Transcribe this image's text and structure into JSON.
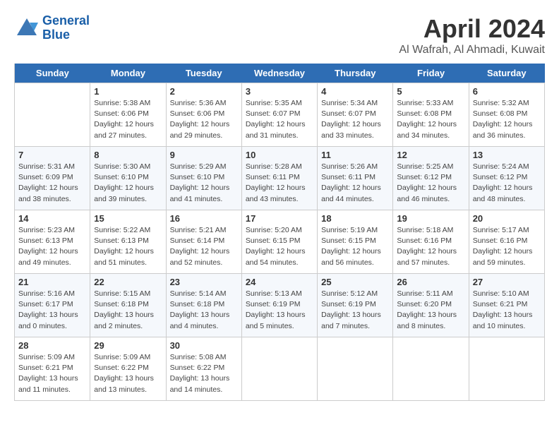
{
  "header": {
    "logo_line1": "General",
    "logo_line2": "Blue",
    "month_year": "April 2024",
    "location": "Al Wafrah, Al Ahmadi, Kuwait"
  },
  "days_of_week": [
    "Sunday",
    "Monday",
    "Tuesday",
    "Wednesday",
    "Thursday",
    "Friday",
    "Saturday"
  ],
  "weeks": [
    [
      {
        "day": "",
        "info": ""
      },
      {
        "day": "1",
        "info": "Sunrise: 5:38 AM\nSunset: 6:06 PM\nDaylight: 12 hours\nand 27 minutes."
      },
      {
        "day": "2",
        "info": "Sunrise: 5:36 AM\nSunset: 6:06 PM\nDaylight: 12 hours\nand 29 minutes."
      },
      {
        "day": "3",
        "info": "Sunrise: 5:35 AM\nSunset: 6:07 PM\nDaylight: 12 hours\nand 31 minutes."
      },
      {
        "day": "4",
        "info": "Sunrise: 5:34 AM\nSunset: 6:07 PM\nDaylight: 12 hours\nand 33 minutes."
      },
      {
        "day": "5",
        "info": "Sunrise: 5:33 AM\nSunset: 6:08 PM\nDaylight: 12 hours\nand 34 minutes."
      },
      {
        "day": "6",
        "info": "Sunrise: 5:32 AM\nSunset: 6:08 PM\nDaylight: 12 hours\nand 36 minutes."
      }
    ],
    [
      {
        "day": "7",
        "info": "Sunrise: 5:31 AM\nSunset: 6:09 PM\nDaylight: 12 hours\nand 38 minutes."
      },
      {
        "day": "8",
        "info": "Sunrise: 5:30 AM\nSunset: 6:10 PM\nDaylight: 12 hours\nand 39 minutes."
      },
      {
        "day": "9",
        "info": "Sunrise: 5:29 AM\nSunset: 6:10 PM\nDaylight: 12 hours\nand 41 minutes."
      },
      {
        "day": "10",
        "info": "Sunrise: 5:28 AM\nSunset: 6:11 PM\nDaylight: 12 hours\nand 43 minutes."
      },
      {
        "day": "11",
        "info": "Sunrise: 5:26 AM\nSunset: 6:11 PM\nDaylight: 12 hours\nand 44 minutes."
      },
      {
        "day": "12",
        "info": "Sunrise: 5:25 AM\nSunset: 6:12 PM\nDaylight: 12 hours\nand 46 minutes."
      },
      {
        "day": "13",
        "info": "Sunrise: 5:24 AM\nSunset: 6:12 PM\nDaylight: 12 hours\nand 48 minutes."
      }
    ],
    [
      {
        "day": "14",
        "info": "Sunrise: 5:23 AM\nSunset: 6:13 PM\nDaylight: 12 hours\nand 49 minutes."
      },
      {
        "day": "15",
        "info": "Sunrise: 5:22 AM\nSunset: 6:13 PM\nDaylight: 12 hours\nand 51 minutes."
      },
      {
        "day": "16",
        "info": "Sunrise: 5:21 AM\nSunset: 6:14 PM\nDaylight: 12 hours\nand 52 minutes."
      },
      {
        "day": "17",
        "info": "Sunrise: 5:20 AM\nSunset: 6:15 PM\nDaylight: 12 hours\nand 54 minutes."
      },
      {
        "day": "18",
        "info": "Sunrise: 5:19 AM\nSunset: 6:15 PM\nDaylight: 12 hours\nand 56 minutes."
      },
      {
        "day": "19",
        "info": "Sunrise: 5:18 AM\nSunset: 6:16 PM\nDaylight: 12 hours\nand 57 minutes."
      },
      {
        "day": "20",
        "info": "Sunrise: 5:17 AM\nSunset: 6:16 PM\nDaylight: 12 hours\nand 59 minutes."
      }
    ],
    [
      {
        "day": "21",
        "info": "Sunrise: 5:16 AM\nSunset: 6:17 PM\nDaylight: 13 hours\nand 0 minutes."
      },
      {
        "day": "22",
        "info": "Sunrise: 5:15 AM\nSunset: 6:18 PM\nDaylight: 13 hours\nand 2 minutes."
      },
      {
        "day": "23",
        "info": "Sunrise: 5:14 AM\nSunset: 6:18 PM\nDaylight: 13 hours\nand 4 minutes."
      },
      {
        "day": "24",
        "info": "Sunrise: 5:13 AM\nSunset: 6:19 PM\nDaylight: 13 hours\nand 5 minutes."
      },
      {
        "day": "25",
        "info": "Sunrise: 5:12 AM\nSunset: 6:19 PM\nDaylight: 13 hours\nand 7 minutes."
      },
      {
        "day": "26",
        "info": "Sunrise: 5:11 AM\nSunset: 6:20 PM\nDaylight: 13 hours\nand 8 minutes."
      },
      {
        "day": "27",
        "info": "Sunrise: 5:10 AM\nSunset: 6:21 PM\nDaylight: 13 hours\nand 10 minutes."
      }
    ],
    [
      {
        "day": "28",
        "info": "Sunrise: 5:09 AM\nSunset: 6:21 PM\nDaylight: 13 hours\nand 11 minutes."
      },
      {
        "day": "29",
        "info": "Sunrise: 5:09 AM\nSunset: 6:22 PM\nDaylight: 13 hours\nand 13 minutes."
      },
      {
        "day": "30",
        "info": "Sunrise: 5:08 AM\nSunset: 6:22 PM\nDaylight: 13 hours\nand 14 minutes."
      },
      {
        "day": "",
        "info": ""
      },
      {
        "day": "",
        "info": ""
      },
      {
        "day": "",
        "info": ""
      },
      {
        "day": "",
        "info": ""
      }
    ]
  ]
}
